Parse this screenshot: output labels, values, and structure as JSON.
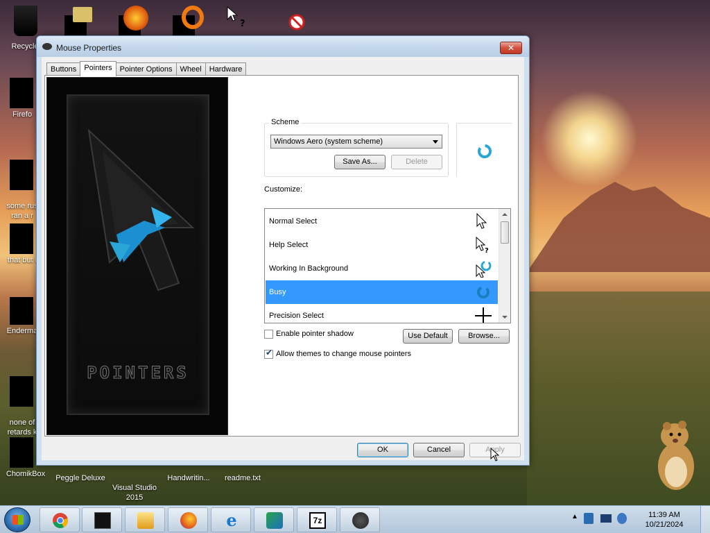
{
  "desktop": {
    "icons": [
      {
        "name": "recycle-bin",
        "label": "Recycle"
      },
      {
        "name": "firefox",
        "label": "Firefo"
      },
      {
        "name": "some-rus",
        "label": "some rus\nran a r"
      },
      {
        "name": "that-but",
        "label": "that but i"
      },
      {
        "name": "enderman",
        "label": "Enderma"
      },
      {
        "name": "none-of",
        "label": "none of\nretards k"
      },
      {
        "name": "chomikbox",
        "label": "ChomikBox"
      },
      {
        "name": "peggle",
        "label": "Peggle Deluxe"
      },
      {
        "name": "visual-studio",
        "label": "Visual Studio\n2015"
      },
      {
        "name": "handwriting",
        "label": "Handwritin..."
      },
      {
        "name": "readme",
        "label": "readme.txt"
      }
    ]
  },
  "window": {
    "title": "Mouse Properties",
    "close_label": "✕",
    "tabs": [
      "Buttons",
      "Pointers",
      "Pointer Options",
      "Wheel",
      "Hardware"
    ],
    "active_tab": "Pointers",
    "preview_word": "POINTERS",
    "scheme": {
      "group_label": "Scheme",
      "selected": "Windows Aero (system scheme)",
      "save_as_label": "Save As...",
      "delete_label": "Delete"
    },
    "customize_label": "Customize:",
    "cursor_list": [
      {
        "label": "Normal Select",
        "icon": "arrow-cursor-icon",
        "selected": false
      },
      {
        "label": "Help Select",
        "icon": "help-cursor-icon",
        "selected": false
      },
      {
        "label": "Working In Background",
        "icon": "working-cursor-icon",
        "selected": false
      },
      {
        "label": "Busy",
        "icon": "busy-cursor-icon",
        "selected": true
      },
      {
        "label": "Precision Select",
        "icon": "crosshair-cursor-icon",
        "selected": false
      }
    ],
    "enable_shadow": {
      "label": "Enable pointer shadow",
      "checked": false
    },
    "allow_themes": {
      "label": "Allow themes to change mouse pointers",
      "checked": true
    },
    "use_default_label": "Use Default",
    "browse_label": "Browse...",
    "ok_label": "OK",
    "cancel_label": "Cancel",
    "apply_label": "Apply"
  },
  "taskbar": {
    "buttons": [
      "chrome-icon",
      "terminal-icon",
      "media-player-icon",
      "firefox-icon",
      "ie-icon",
      "internet-download-manager-icon",
      "7zip-icon",
      "mouse-icon"
    ],
    "seven_zip_label": "7z",
    "clock_time": "11:39 AM",
    "clock_date": "10/21/2024"
  },
  "colors": {
    "selection": "#3399ff",
    "busy_cursor": "#2aa6d6"
  }
}
